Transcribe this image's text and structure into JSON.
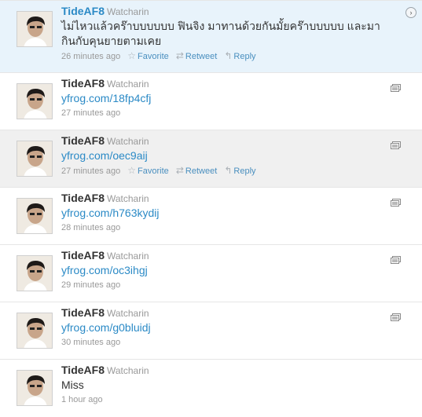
{
  "tweets": [
    {
      "screen_name": "TideAF8",
      "full_name": "Watcharin",
      "text": "ไม่ไหวแล้วคร๊าบบบบบบ ฟินจิง มาทานด้วยกันมั้ยคร๊าบบบบบ และมากินกับคุนยายตามเคย",
      "time": "26 minutes ago",
      "actions": {
        "favorite": "Favorite",
        "retweet": "Retweet",
        "reply": "Reply"
      }
    },
    {
      "screen_name": "TideAF8",
      "full_name": "Watcharin",
      "text": "yfrog.com/18fp4cfj",
      "time": "27 minutes ago"
    },
    {
      "screen_name": "TideAF8",
      "full_name": "Watcharin",
      "text": "yfrog.com/oec9aij",
      "time": "27 minutes ago",
      "actions": {
        "favorite": "Favorite",
        "retweet": "Retweet",
        "reply": "Reply"
      }
    },
    {
      "screen_name": "TideAF8",
      "full_name": "Watcharin",
      "text": "yfrog.com/h763kydij",
      "time": "28 minutes ago"
    },
    {
      "screen_name": "TideAF8",
      "full_name": "Watcharin",
      "text": "yfrog.com/oc3ihgj",
      "time": "29 minutes ago"
    },
    {
      "screen_name": "TideAF8",
      "full_name": "Watcharin",
      "text": "yfrog.com/g0bluidj",
      "time": "30 minutes ago"
    },
    {
      "screen_name": "TideAF8",
      "full_name": "Watcharin",
      "text": "Miss",
      "time": "1 hour ago"
    }
  ],
  "icons": {
    "favorite": "star-icon",
    "retweet": "retweet-icon",
    "reply": "reply-arrow-icon",
    "photo": "photo-icon",
    "expand": "expand-arrow-icon"
  },
  "colors": {
    "link": "#2b8ac6",
    "highlight_row": "#e8f3fb",
    "hover_row": "#f0f0f0"
  }
}
